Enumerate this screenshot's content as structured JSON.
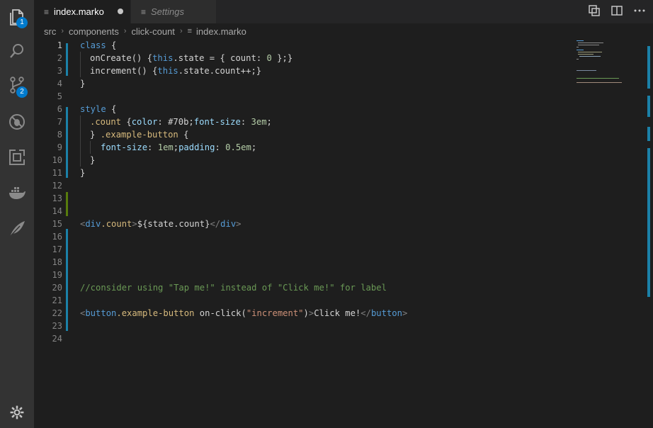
{
  "activity_bar": {
    "explorer_badge": "1",
    "scm_badge": "2"
  },
  "tabs": [
    {
      "label": "index.marko",
      "active": true,
      "dirty": true
    },
    {
      "label": "Settings",
      "active": false
    }
  ],
  "breadcrumb": [
    "src",
    "components",
    "click-count",
    "index.marko"
  ],
  "editor": {
    "current_line": 1,
    "line_numbers": [
      "1",
      "2",
      "3",
      "4",
      "5",
      "6",
      "7",
      "8",
      "9",
      "10",
      "11",
      "12",
      "13",
      "14",
      "15",
      "16",
      "17",
      "18",
      "19",
      "20",
      "21",
      "22",
      "23",
      "24"
    ],
    "lines": {
      "l1": [
        "class",
        " {"
      ],
      "l2": [
        "onCreate() {",
        "this",
        ".state = { count: ",
        "0",
        " };}"
      ],
      "l3": [
        "increment() {",
        "this",
        ".state.count++;}"
      ],
      "l4": [
        "}"
      ],
      "l6": [
        "style",
        " {"
      ],
      "l7": [
        ".count",
        " {",
        "color",
        ": #70b;",
        "font-size",
        ": ",
        "3em",
        ";"
      ],
      "l8": [
        "} ",
        ".example-button",
        " {"
      ],
      "l9": [
        "font-size",
        ": ",
        "1em",
        ";",
        "padding",
        ": ",
        "0.5em",
        ";"
      ],
      "l10": [
        "}"
      ],
      "l11": [
        "}"
      ],
      "l15": [
        "<",
        "div",
        ".count",
        ">",
        "${state.count}",
        "</",
        "div",
        ">"
      ],
      "l20": [
        "//consider using \"Tap me!\" instead of \"Click me!\" for label"
      ],
      "l22": [
        "<",
        "button",
        ".example-button",
        " on-click(",
        "\"increment\"",
        ")",
        ">",
        "Click me!",
        "</",
        "button",
        ">"
      ]
    }
  },
  "colors": {
    "keyword": "#569cd6",
    "string": "#ce9178",
    "comment": "#6a9955",
    "number": "#b5cea8",
    "diff_modified": "#1b81a8",
    "diff_added": "#587c0c"
  }
}
